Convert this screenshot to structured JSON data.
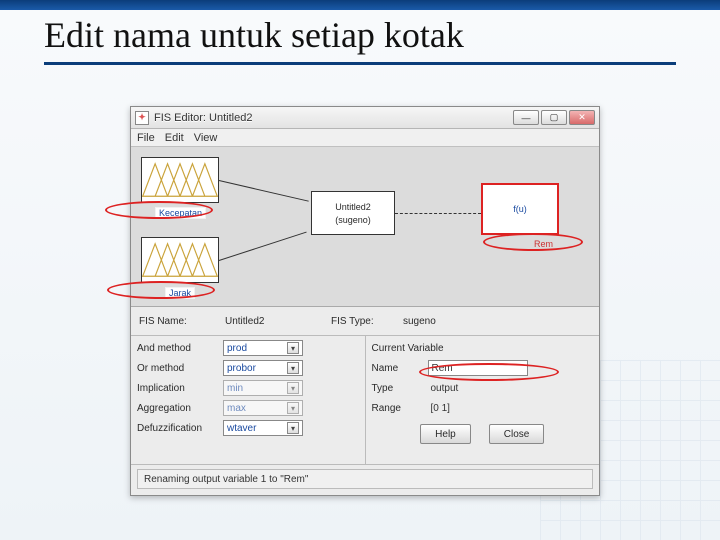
{
  "slide": {
    "title_text": "Edit nama untuk setiap kotak"
  },
  "window": {
    "title": "FIS Editor: Untitled2",
    "menubar": {
      "file": "File",
      "edit": "Edit",
      "view": "View"
    },
    "canvas": {
      "input1_label": "Kecepatan",
      "input2_label": "Jarak",
      "rule_name": "Untitled2",
      "rule_type": "(sugeno)",
      "output_text": "f(u)",
      "output_label": "Rem"
    },
    "info": {
      "fis_name_label": "FIS Name:",
      "fis_name_value": "Untitled2",
      "fis_type_label": "FIS Type:",
      "fis_type_value": "sugeno"
    },
    "methods": {
      "and_label": "And method",
      "and_value": "prod",
      "or_label": "Or method",
      "or_value": "probor",
      "imp_label": "Implication",
      "imp_value": "min",
      "agg_label": "Aggregation",
      "agg_value": "max",
      "defuzz_label": "Defuzzification",
      "defuzz_value": "wtaver"
    },
    "current": {
      "header": "Current Variable",
      "name_label": "Name",
      "name_value": "Rem",
      "type_label": "Type",
      "type_value": "output",
      "range_label": "Range",
      "range_value": "[0 1]"
    },
    "buttons": {
      "help": "Help",
      "close": "Close"
    },
    "status": "Renaming output variable 1 to \"Rem\""
  }
}
